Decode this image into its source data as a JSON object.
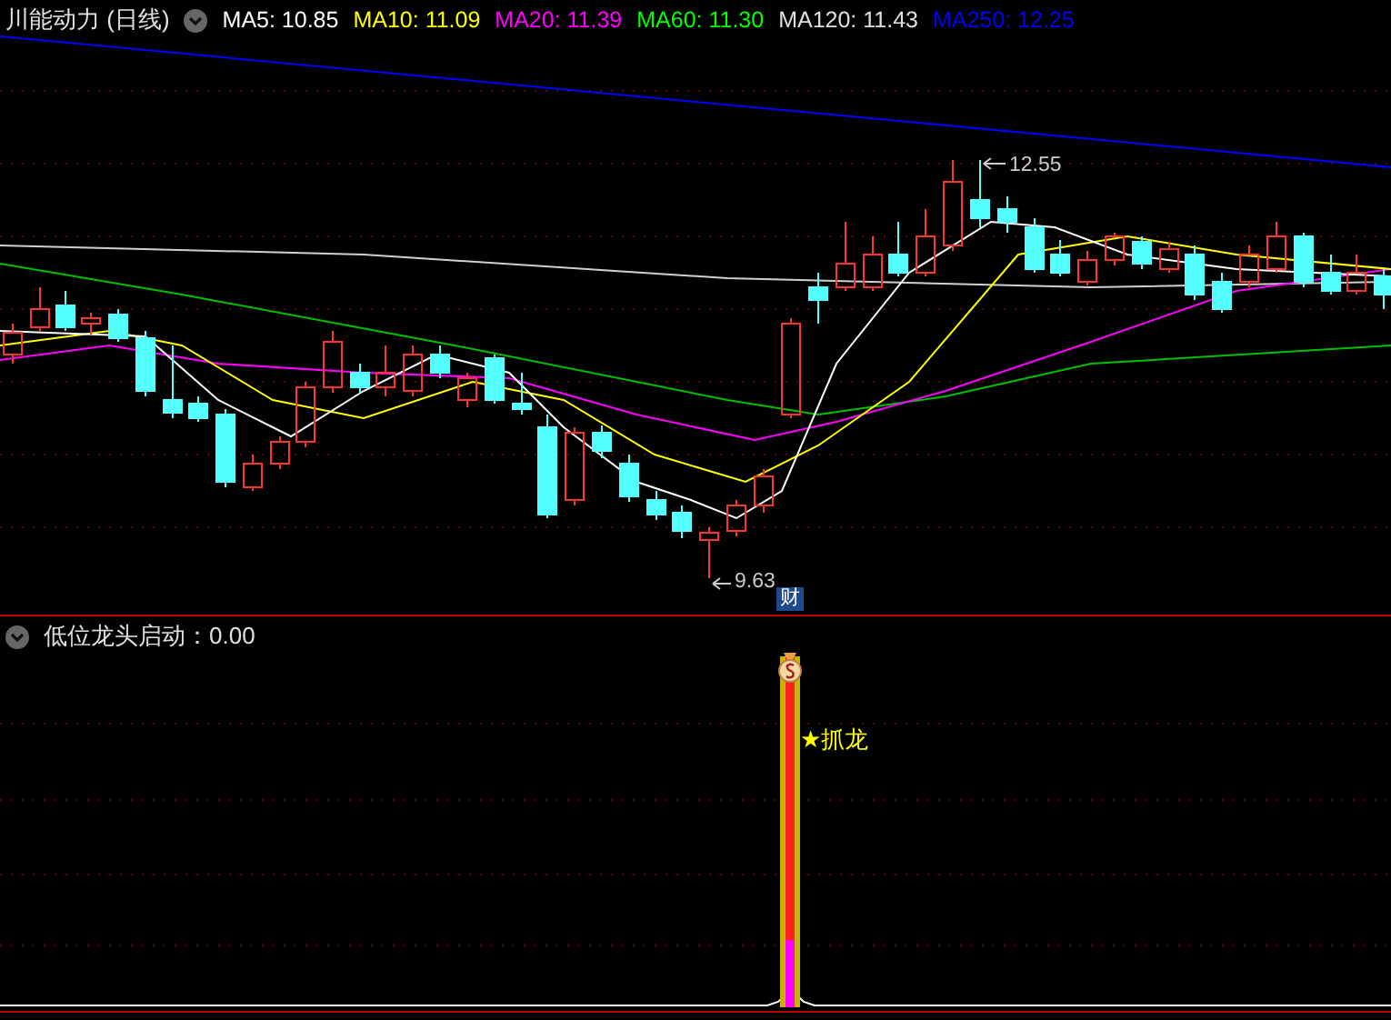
{
  "chart": {
    "title": "川能动力 (日线)",
    "indicators": [
      {
        "label": "MA5: 10.85",
        "color": "#ffffff"
      },
      {
        "label": "MA10: 11.09",
        "color": "#ffff00"
      },
      {
        "label": "MA20: 11.39",
        "color": "#ff00ff"
      },
      {
        "label": "MA60: 11.30",
        "color": "#00ff00"
      },
      {
        "label": "MA120: 11.43",
        "color": "#e0e0e0"
      },
      {
        "label": "MA250: 12.25",
        "color": "#0000ff"
      }
    ],
    "high_label": "12.55",
    "low_label": "9.63",
    "badge": "财"
  },
  "indicator_panel": {
    "title": "低位龙头启动：0.00",
    "signal": "★抓龙"
  }
}
